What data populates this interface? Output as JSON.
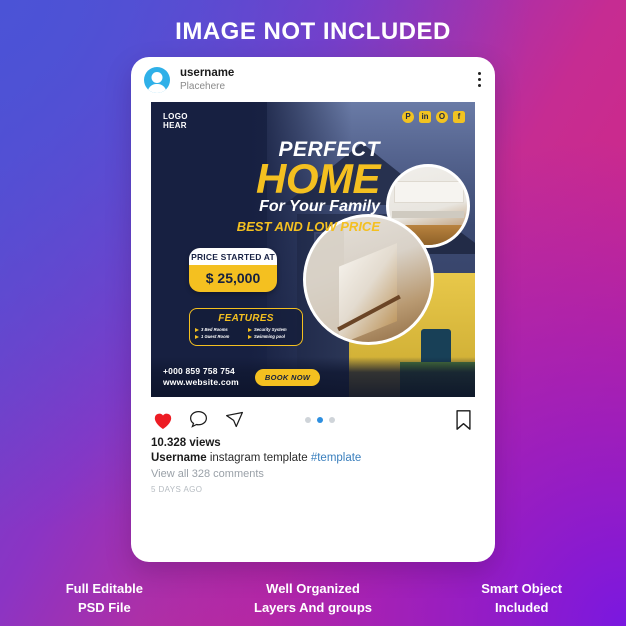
{
  "headline": "IMAGE NOT INCLUDED",
  "theme": {
    "accent_yellow": "#f4c020",
    "deep_navy": "#1b2747",
    "link_blue": "#3a7fbd",
    "heart_red": "#ed1c24",
    "bg_gradient_start": "#4b53d6",
    "bg_gradient_mid": "#c62c92",
    "bg_gradient_end": "#7a18e0"
  },
  "post": {
    "username": "username",
    "subtitle": "Placehere",
    "menu_icon": "more-options-icon"
  },
  "creative": {
    "logo_line1": "LOGO",
    "logo_line2": "HEAR",
    "socials": [
      {
        "name": "pinterest-icon",
        "glyph": "P"
      },
      {
        "name": "linkedin-icon",
        "glyph": "in"
      },
      {
        "name": "instagram-icon",
        "glyph": "O"
      },
      {
        "name": "facebook-icon",
        "glyph": "f"
      }
    ],
    "title_small": "PERFECT",
    "title_big": "HOME",
    "subtitle": "For Your Family",
    "tagline": "BEST AND LOW PRICE",
    "price_label": "PRICE STARTED AT",
    "price_value": "$ 25,000",
    "features_title": "FEATURES",
    "features": [
      "3 Bed Rooms",
      "Security System",
      "1 Guest Room",
      "Swimming pool"
    ],
    "phone": "+000 859 758 754",
    "website": "www.website.com",
    "cta": "BOOK NOW"
  },
  "actions": {
    "like": "heart-icon",
    "comment": "comment-icon",
    "share": "share-icon",
    "save": "bookmark-icon",
    "pager_count": 3,
    "pager_active": 2
  },
  "meta": {
    "views": "10.328 views",
    "caption_user": "Username",
    "caption_text": "instagram template",
    "caption_tag": "#template",
    "comments": "View all 328 comments",
    "timestamp": "5 DAYS AGO"
  },
  "footer": [
    {
      "line1": "Full Editable",
      "line2": "PSD File"
    },
    {
      "line1": "Well Organized",
      "line2": "Layers And groups"
    },
    {
      "line1": "Smart Object",
      "line2": "Included"
    }
  ]
}
